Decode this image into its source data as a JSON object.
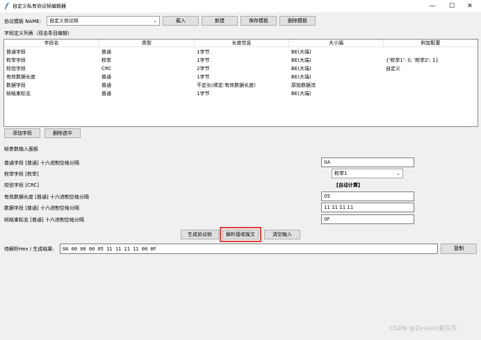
{
  "window": {
    "title": "自定义私有协议帧编辑器",
    "minimize": "—",
    "maximize": "☐",
    "close": "✕"
  },
  "template_bar": {
    "label": "协议模板 NAME:",
    "selected": "自定义协议帧",
    "load": "载入",
    "new": "新建",
    "save": "保存模板",
    "delete": "删除模板"
  },
  "fields_table": {
    "caption": "字段定义列表（双击条目编辑）",
    "columns": [
      "字段名",
      "类型",
      "长度信息",
      "大小端",
      "附加配置"
    ],
    "rows": [
      [
        "普通字段",
        "普通",
        "1字节",
        "BE(大端)",
        ""
      ],
      [
        "枚举字段",
        "枚举",
        "1字节",
        "BE(大端)",
        "{'枚举1': 0, '枚举2': 1}"
      ],
      [
        "校验字段",
        "CRC",
        "2字节",
        "BE(大端)",
        "自定义"
      ],
      [
        "有效数据长度",
        "普通",
        "1字节",
        "BE(大端)",
        ""
      ],
      [
        "数据字段",
        "普通",
        "不定长(绑定:有效数据长度)",
        "原始数据流",
        ""
      ],
      [
        "帧结束标志",
        "普通",
        "1字节",
        "BE(大端)",
        ""
      ]
    ],
    "add_button": "添加字段",
    "delete_button": "删除选中"
  },
  "params_panel": {
    "title": "帧参数输入面板",
    "fields": [
      {
        "label": "普通字段 [普通] 十六进制空格分隔",
        "value": "0A"
      },
      {
        "label": "枚举字段 [枚举]",
        "value": "枚举1"
      },
      {
        "label": "校验字段 [CRC]",
        "value": "【自动计算】"
      },
      {
        "label": "有效数据长度 [普通] 十六进制空格分隔",
        "value": "05"
      },
      {
        "label": "数据字段 [普通] 十六进制空格分隔",
        "value": "11 11 11 11"
      },
      {
        "label": "帧结束标志 [普通] 十六进制空格分隔",
        "value": "0F"
      }
    ]
  },
  "actions": {
    "generate": "生成协议帧",
    "parse": "解析接收报文",
    "clear": "清空输入"
  },
  "hex_bar": {
    "label": "待解析Hex / 生成结果:",
    "value": "0A 00 00 00 05 11 11 11 11 00 0F",
    "copy": "复制"
  },
  "watermark": "CSDN @Zevalin爱灰灰",
  "colors": {
    "highlight": "#e0403a",
    "window_bg": "#f0f0f0"
  },
  "icons": {
    "app": "feather-icon",
    "dropdown": "chevron-down-icon"
  }
}
